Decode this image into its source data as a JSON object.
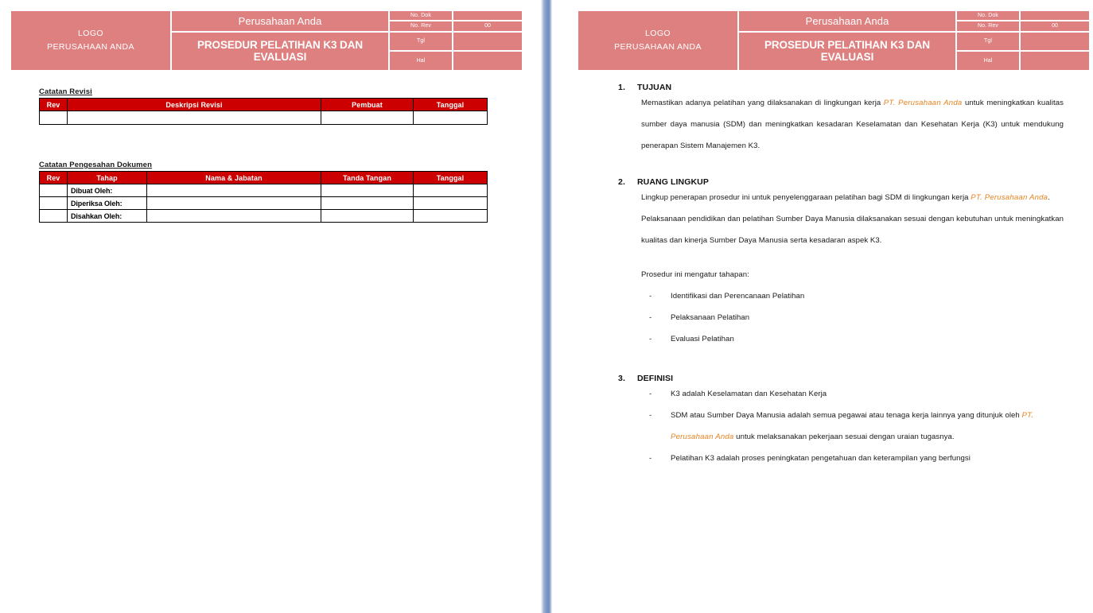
{
  "document": {
    "header": {
      "logo_line1": "LOGO",
      "logo_line2": "PERUSAHAAN ANDA",
      "company": "Perusahaan Anda",
      "title": "PROSEDUR PELATIHAN K3 DAN EVALUASI",
      "meta": [
        {
          "label": "No. Dok",
          "value": ""
        },
        {
          "label": "No. Rev",
          "value": "00"
        },
        {
          "label": "Tgl",
          "value": ""
        },
        {
          "label": "Hal",
          "value": ""
        }
      ]
    },
    "colors": {
      "header_fill": "#df8080",
      "table_header_fill": "#cc0000",
      "company_accent": "#e8821e",
      "scrollbar": "#7e9ac6"
    }
  },
  "left_page": {
    "revision_table": {
      "caption": "Catatan Revisi",
      "columns": [
        "Rev",
        "Deskripsi Revisi",
        "Pembuat",
        "Tanggal"
      ],
      "rows": [
        [
          "",
          "",
          "",
          ""
        ]
      ]
    },
    "approval_table": {
      "caption": "Catatan Pengesahan Dokumen",
      "columns": [
        "Rev",
        "Tahap",
        "Nama & Jabatan",
        "Tanda Tangan",
        "Tanggal"
      ],
      "rows": [
        [
          "",
          "Dibuat Oleh:",
          "",
          "",
          ""
        ],
        [
          "",
          "Diperiksa Oleh:",
          "",
          "",
          ""
        ],
        [
          "",
          "Disahkan Oleh:",
          "",
          "",
          ""
        ]
      ]
    }
  },
  "right_page": {
    "sections": [
      {
        "number": "1.",
        "title": "TUJUAN",
        "paragraph_1a": "Memastikan adanya pelatihan yang dilaksanakan di lingkungan kerja ",
        "company": "PT. Perusahaan Anda",
        "paragraph_1b": " untuk meningkatkan kualitas sumber daya manusia (SDM) dan meningkatkan kesadaran Keselamatan dan Kesehatan Kerja (K3) untuk mendukung penerapan Sistem Manajemen K3."
      },
      {
        "number": "2.",
        "title": "RUANG LINGKUP",
        "paragraph_2a": "Lingkup penerapan prosedur ini untuk penyelenggaraan pelatihan bagi SDM di lingkungan kerja ",
        "company": "PT. Perusahaan Anda",
        "paragraph_2b": ".",
        "paragraph_3": "Pelaksanaan pendidikan dan pelatihan Sumber Daya Manusia dilaksanakan sesuai dengan kebutuhan untuk meningkatkan kualitas dan kinerja Sumber Daya Manusia serta kesadaran aspek K3.",
        "list_intro": "Prosedur ini mengatur tahapan:",
        "list_items": [
          "Identifikasi dan Perencanaan Pelatihan",
          "Pelaksanaan Pelatihan",
          "Evaluasi Pelatihan"
        ]
      },
      {
        "number": "3.",
        "title": "DEFINISI",
        "item_1": "K3 adalah Keselamatan dan Kesehatan Kerja",
        "item_2a": "SDM atau Sumber Daya Manusia adalah semua pegawai atau tenaga kerja lainnya yang ditunjuk oleh ",
        "company": "PT. Perusahaan Anda",
        "item_2b": " untuk melaksanakan pekerjaan sesuai dengan uraian tugasnya.",
        "item_3": "Pelatihan K3 adalah proses peningkatan pengetahuan dan keterampilan yang berfungsi"
      }
    ],
    "list_dash": "-"
  }
}
